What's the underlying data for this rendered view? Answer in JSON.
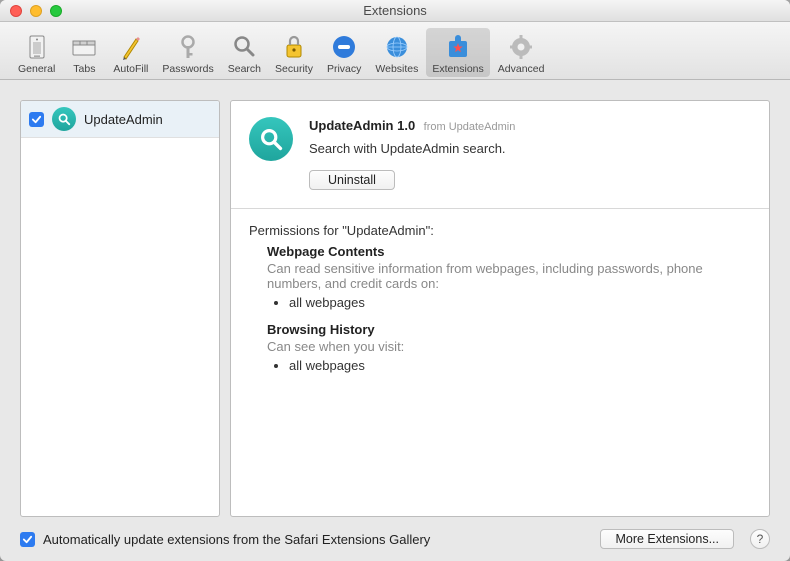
{
  "window": {
    "title": "Extensions"
  },
  "toolbar": {
    "items": [
      {
        "label": "General"
      },
      {
        "label": "Tabs"
      },
      {
        "label": "AutoFill"
      },
      {
        "label": "Passwords"
      },
      {
        "label": "Search"
      },
      {
        "label": "Security"
      },
      {
        "label": "Privacy"
      },
      {
        "label": "Websites"
      },
      {
        "label": "Extensions"
      },
      {
        "label": "Advanced"
      }
    ]
  },
  "sidebar": {
    "items": [
      {
        "name": "UpdateAdmin",
        "checked": true
      }
    ]
  },
  "detail": {
    "title": "UpdateAdmin 1.0",
    "from": "from UpdateAdmin",
    "description": "Search with UpdateAdmin search.",
    "uninstall": "Uninstall"
  },
  "permissions": {
    "heading": "Permissions for \"UpdateAdmin\":",
    "groups": [
      {
        "title": "Webpage Contents",
        "desc": "Can read sensitive information from webpages, including passwords, phone numbers, and credit cards on:",
        "items": [
          "all webpages"
        ]
      },
      {
        "title": "Browsing History",
        "desc": "Can see when you visit:",
        "items": [
          "all webpages"
        ]
      }
    ]
  },
  "footer": {
    "autoUpdate": "Automatically update extensions from the Safari Extensions Gallery",
    "moreExtensions": "More Extensions...",
    "help": "?"
  }
}
